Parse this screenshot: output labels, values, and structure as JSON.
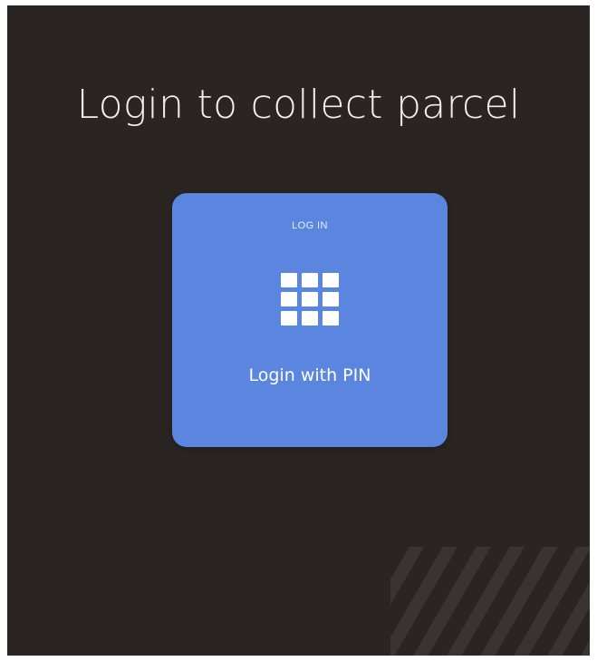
{
  "header": {
    "title": "Login to collect parcel"
  },
  "login_tile": {
    "caption": "LOG IN",
    "label": "Login with PIN",
    "icon": "keypad-grid-icon",
    "color": "#5b86e0"
  },
  "theme": {
    "background": "#2a2522",
    "text": "#f2efe9"
  }
}
